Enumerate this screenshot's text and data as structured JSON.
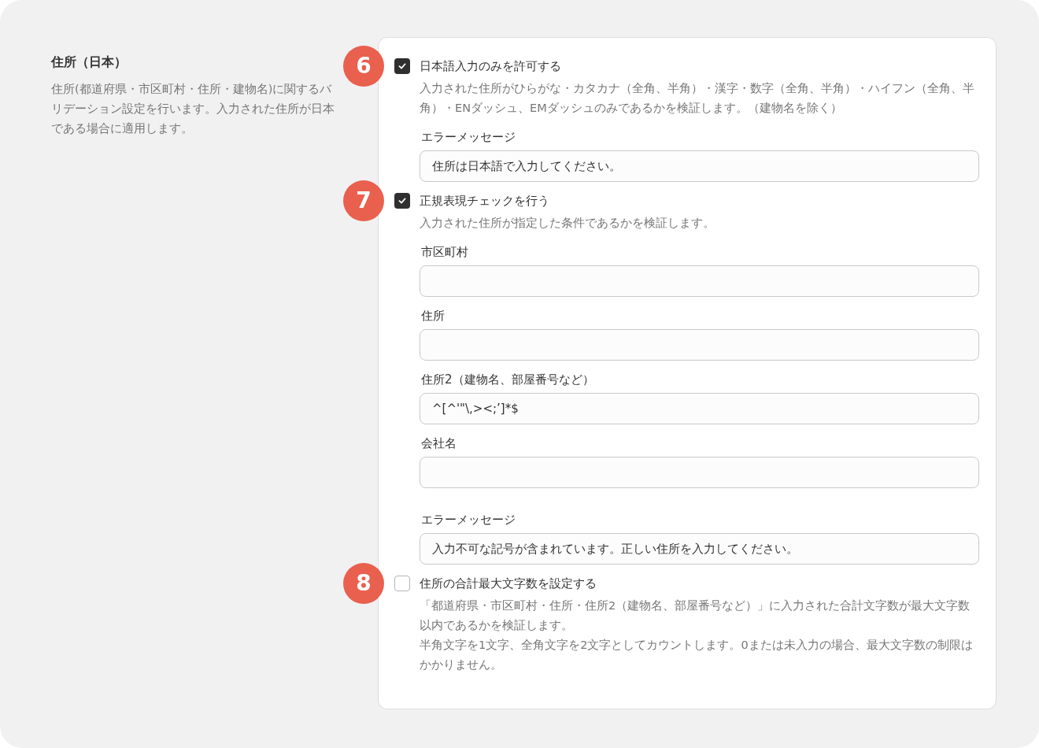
{
  "intro": {
    "title": "住所（日本）",
    "description": "住所(都道府県・市区町村・住所・建物名)に関するバリデーション設定を行います。入力された住所が日本である場合に適用します。"
  },
  "sections": [
    {
      "badge": "6",
      "checked": true,
      "label": "日本語入力のみを許可する",
      "description": [
        "入力された住所がひらがな・カタカナ（全角、半角）・漢字・数字（全角、半角）・ハイフン（全角、半角）・ENダッシュ、EMダッシュのみであるかを検証します。（建物名を除く）"
      ],
      "fields": [
        {
          "kind": "message",
          "label": "エラーメッセージ",
          "value": "住所は日本語で入力してください。"
        }
      ]
    },
    {
      "badge": "7",
      "checked": true,
      "label": "正規表現チェックを行う",
      "description": [
        "入力された住所が指定した条件であるかを検証します。"
      ],
      "fields": [
        {
          "kind": "pattern",
          "label": "市区町村"
        },
        {
          "kind": "pattern",
          "label": "住所"
        },
        {
          "kind": "pattern",
          "label": "住所2（建物名、部屋番号など）",
          "value": "^[^'\"\\,><;’]*$"
        },
        {
          "kind": "pattern",
          "label": "会社名"
        },
        {
          "kind": "message",
          "label": "エラーメッセージ",
          "value": "入力不可な記号が含まれています。正しい住所を入力してください。"
        }
      ]
    },
    {
      "badge": "8",
      "checked": false,
      "label": "住所の合計最大文字数を設定する",
      "description": [
        "「都道府県・市区町村・住所・住所2（建物名、部屋番号など）」に入力された合計文字数が最大文字数以内であるかを検証します。",
        "半角文字を1文字、全角文字を2文字としてカウントします。0または未入力の場合、最大文字数の制限はかかりません。"
      ]
    }
  ]
}
